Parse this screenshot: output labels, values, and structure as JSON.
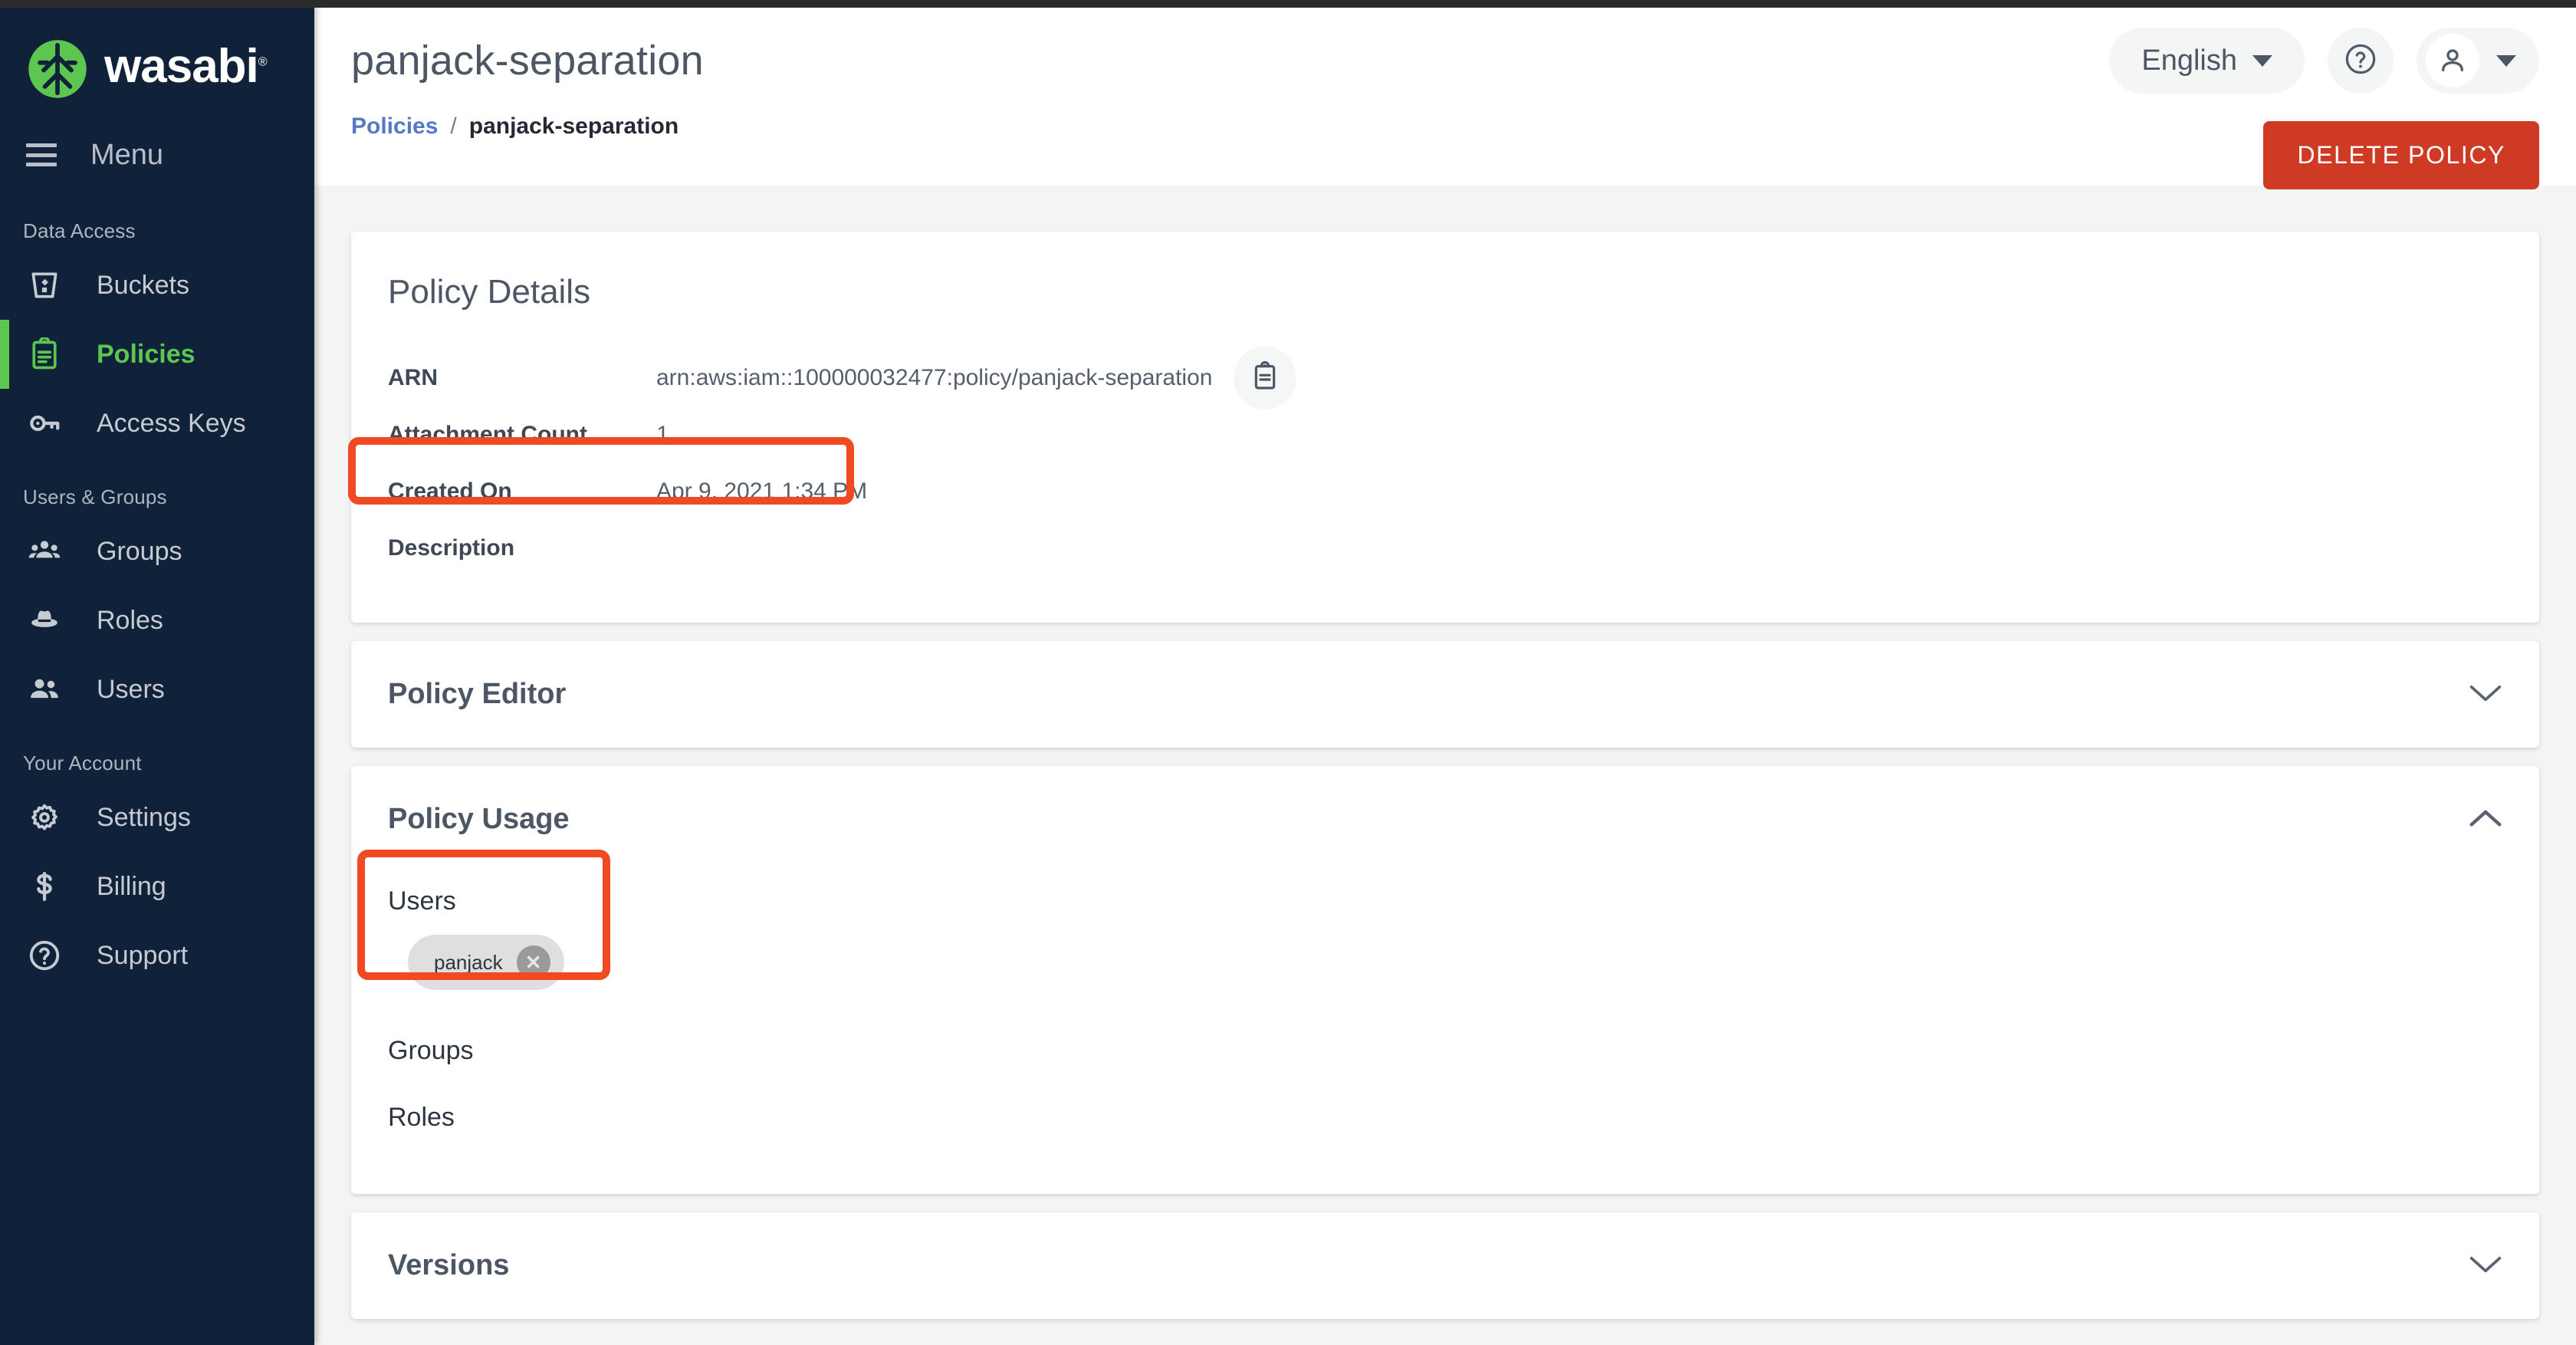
{
  "brand": {
    "name": "wasabi",
    "registered": "®"
  },
  "sidebar": {
    "menu_label": "Menu",
    "sections": [
      {
        "title": "Data Access",
        "items": [
          {
            "label": "Buckets",
            "icon": "bucket-icon",
            "active": false
          },
          {
            "label": "Policies",
            "icon": "clipboard-icon",
            "active": true
          },
          {
            "label": "Access Keys",
            "icon": "key-icon",
            "active": false
          }
        ]
      },
      {
        "title": "Users & Groups",
        "items": [
          {
            "label": "Groups",
            "icon": "group-icon",
            "active": false
          },
          {
            "label": "Roles",
            "icon": "hat-icon",
            "active": false
          },
          {
            "label": "Users",
            "icon": "users-icon",
            "active": false
          }
        ]
      },
      {
        "title": "Your Account",
        "items": [
          {
            "label": "Settings",
            "icon": "gear-icon",
            "active": false
          },
          {
            "label": "Billing",
            "icon": "dollar-icon",
            "active": false
          },
          {
            "label": "Support",
            "icon": "help-circle-icon",
            "active": false
          }
        ]
      }
    ]
  },
  "header": {
    "title": "panjack-separation",
    "breadcrumb": {
      "parent": "Policies",
      "separator": "/",
      "current": "panjack-separation"
    },
    "language": "English",
    "help_icon": "question-circle-icon",
    "account_icon": "person-icon",
    "delete_button": "DELETE POLICY"
  },
  "policy_details": {
    "card_title": "Policy Details",
    "rows": [
      {
        "label": "ARN",
        "value": "arn:aws:iam::100000032477:policy/panjack-separation"
      },
      {
        "label": "Attachment Count",
        "value": "1"
      },
      {
        "label": "Created On",
        "value": "Apr 9, 2021 1:34 PM"
      },
      {
        "label": "Description",
        "value": ""
      }
    ],
    "copy_icon": "clipboard-copy-icon"
  },
  "accordions": {
    "policy_editor": {
      "title": "Policy Editor",
      "state": "collapsed",
      "chevron": "chevron-down-icon"
    },
    "policy_usage": {
      "title": "Policy Usage",
      "state": "expanded",
      "chevron": "chevron-up-icon"
    },
    "versions": {
      "title": "Versions",
      "state": "collapsed",
      "chevron": "chevron-down-icon"
    }
  },
  "policy_usage": {
    "users_label": "Users",
    "user_chips": [
      {
        "name": "panjack",
        "remove_icon": "close-circle-icon"
      }
    ],
    "groups_label": "Groups",
    "roles_label": "Roles"
  },
  "colors": {
    "sidebar_bg": "#10213a",
    "accent_green": "#5dc650",
    "delete_red": "#cf3a25",
    "annotation_red": "#f04a23",
    "link_blue": "#5578c7",
    "page_bg": "#f3f4f4"
  }
}
